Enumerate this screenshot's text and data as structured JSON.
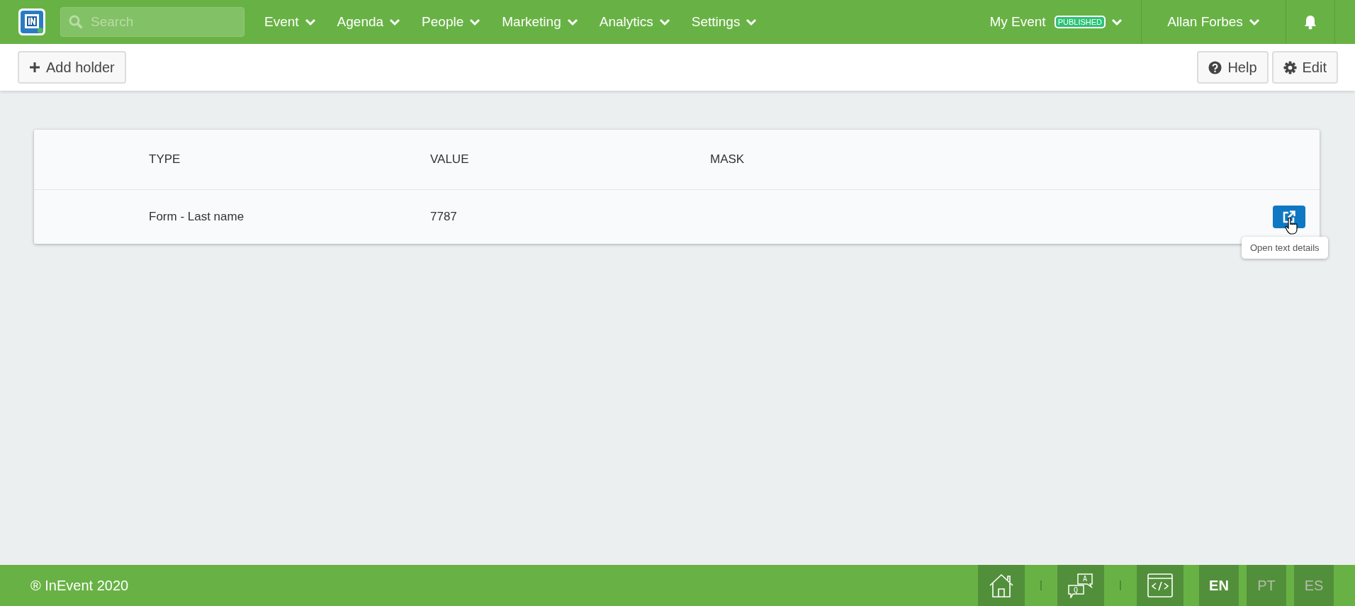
{
  "topbar": {
    "search": {
      "placeholder": "Search"
    },
    "nav": [
      {
        "label": "Event"
      },
      {
        "label": "Agenda"
      },
      {
        "label": "People"
      },
      {
        "label": "Marketing"
      },
      {
        "label": "Analytics"
      },
      {
        "label": "Settings"
      }
    ],
    "event": {
      "label": "My Event",
      "badge": "PUBLISHED"
    },
    "user": {
      "label": "Allan Forbes"
    }
  },
  "toolbar": {
    "left": [
      {
        "kind": "add",
        "label": "Add holder"
      }
    ],
    "right": [
      {
        "kind": "help",
        "label": "Help"
      },
      {
        "kind": "edit",
        "label": "Edit"
      }
    ]
  },
  "table": {
    "columns": [
      "TYPE",
      "VALUE",
      "MASK"
    ],
    "rows": [
      {
        "cells": [
          "Form - Last name",
          "7787",
          ""
        ],
        "tooltip": "Open text details"
      }
    ]
  },
  "footer": {
    "copyright": "® InEvent 2020",
    "icons": [
      {
        "kind": "home"
      },
      {
        "kind": "qa",
        "letters": [
          "Q",
          "A"
        ]
      },
      {
        "kind": "code"
      }
    ],
    "languages": [
      {
        "label": "EN",
        "selected": true
      },
      {
        "label": "PT",
        "selected": false
      },
      {
        "label": "ES",
        "selected": false
      }
    ]
  }
}
